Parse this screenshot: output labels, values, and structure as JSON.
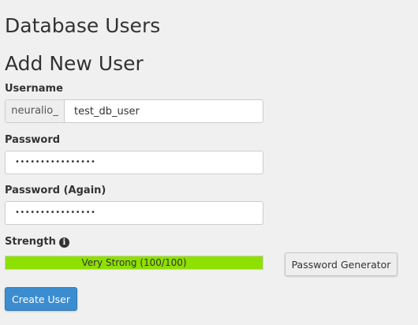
{
  "header": {
    "section_title": "Database Users",
    "form_title": "Add New User"
  },
  "username": {
    "label": "Username",
    "prefix": "neuralio_",
    "value": "test_db_user"
  },
  "password": {
    "label": "Password",
    "masked_value": "••••••••••••••••"
  },
  "password_again": {
    "label": "Password (Again)",
    "masked_value": "••••••••••••••••"
  },
  "strength": {
    "label": "Strength",
    "info_icon": "info-circle-icon",
    "text": "Very Strong (100/100)",
    "score": 100,
    "max": 100,
    "bar_color": "#8ee000"
  },
  "buttons": {
    "generator_label": "Password Generator",
    "create_label": "Create User",
    "create_color": "#3c8dd0"
  }
}
